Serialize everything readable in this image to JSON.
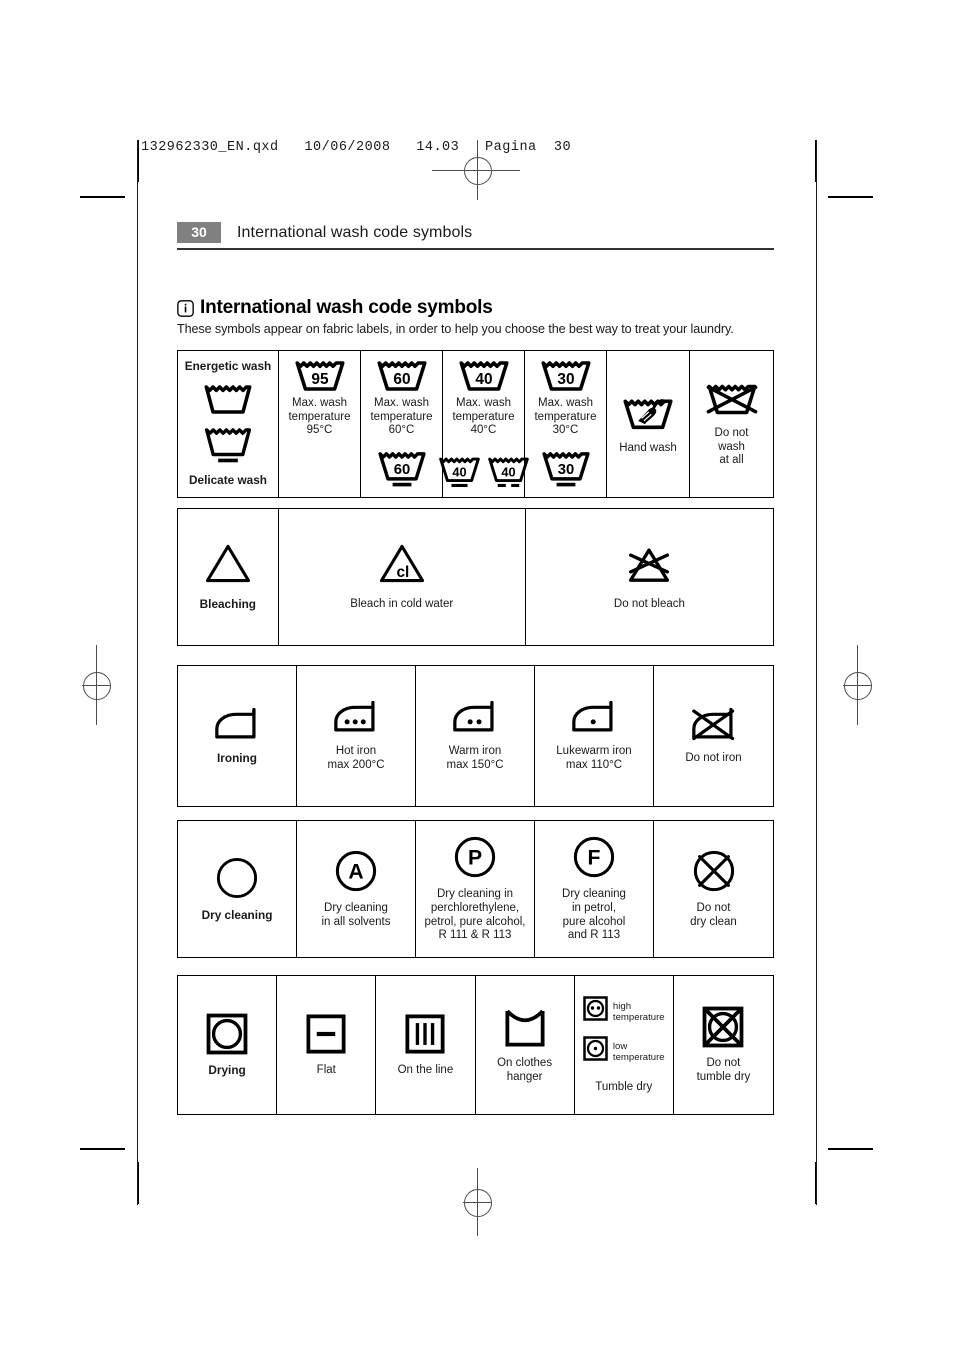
{
  "print_header": {
    "text": "132962330_EN.qxd   10/06/2008   14.03   Pagina  30"
  },
  "page_header": {
    "page_number": "30",
    "title": "International wash code symbols"
  },
  "section": {
    "icon": "info-icon",
    "title": "International wash code symbols",
    "intro": "These symbols appear on fabric labels, in order to help you choose the best way to treat your laundry."
  },
  "tables": {
    "washing": {
      "label_top": "Energetic wash",
      "label_bottom": "Delicate wash",
      "columns": [
        {
          "temp": "95",
          "caption": "Max. wash\ntemperature\n95°C",
          "delicate": []
        },
        {
          "temp": "60",
          "caption": "Max. wash\ntemperature\n60°C",
          "delicate": [
            "60"
          ]
        },
        {
          "temp": "40",
          "caption": "Max. wash\ntemperature\n40°C",
          "delicate": [
            "40",
            "40"
          ]
        },
        {
          "temp": "30",
          "caption": "Max. wash\ntemperature\n30°C",
          "delicate": [
            "30"
          ]
        }
      ],
      "hand_wash": {
        "icon": "hand-wash-icon",
        "caption": "Hand wash"
      },
      "do_not_wash": {
        "icon": "do-not-wash-icon",
        "caption": "Do not\nwash\nat all"
      }
    },
    "bleaching": {
      "label": "Bleaching",
      "cells": [
        {
          "icon": "bleach-cold-icon",
          "caption": "Bleach in cold water"
        },
        {
          "icon": "do-not-bleach-icon",
          "caption": "Do not bleach"
        }
      ]
    },
    "ironing": {
      "label": "Ironing",
      "cells": [
        {
          "icon": "iron-hot-icon",
          "caption": "Hot iron\nmax 200°C"
        },
        {
          "icon": "iron-warm-icon",
          "caption": "Warm iron\nmax 150°C"
        },
        {
          "icon": "iron-lukewarm-icon",
          "caption": "Lukewarm iron\nmax 110°C"
        },
        {
          "icon": "do-not-iron-icon",
          "caption": "Do not iron"
        }
      ]
    },
    "dry_cleaning": {
      "label": "Dry cleaning",
      "cells": [
        {
          "icon": "dryclean-a-icon",
          "caption": "Dry cleaning\nin all solvents"
        },
        {
          "icon": "dryclean-p-icon",
          "caption": "Dry cleaning in\nperchlorethylene,\npetrol, pure alcohol,\nR 111 & R 113"
        },
        {
          "icon": "dryclean-f-icon",
          "caption": "Dry cleaning\nin petrol,\npure alcohol\nand R 113"
        },
        {
          "icon": "do-not-dryclean-icon",
          "caption": "Do not\ndry clean"
        }
      ]
    },
    "drying": {
      "label": "Drying",
      "cells": [
        {
          "icon": "dry-flat-icon",
          "caption": "Flat"
        },
        {
          "icon": "dry-line-icon",
          "caption": "On the line"
        },
        {
          "icon": "dry-hanger-icon",
          "caption": "On clothes\nhanger"
        }
      ],
      "tumble": {
        "caption": "Tumble dry",
        "high": "high\ntemperature",
        "low": "low\ntemperature"
      },
      "do_not_tumble": {
        "icon": "do-not-tumble-icon",
        "caption": "Do not\ntumble dry"
      }
    }
  },
  "colors": {
    "badge": "#808080",
    "ink": "#000000",
    "rule": "#333333"
  }
}
